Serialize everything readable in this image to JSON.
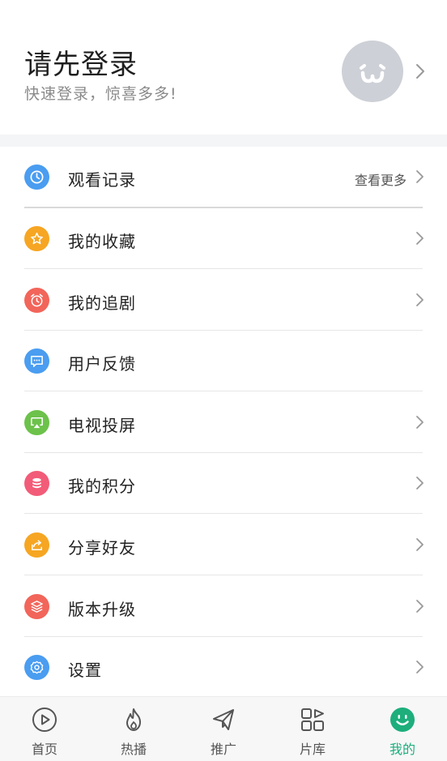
{
  "header": {
    "title": "请先登录",
    "subtitle": "快速登录，惊喜多多!"
  },
  "menu": {
    "items": [
      {
        "id": "history",
        "label": "观看记录",
        "more": "查看更多",
        "icon": "clock-icon",
        "color": "#4a9df0",
        "chevron": true
      },
      {
        "id": "favorites",
        "label": "我的收藏",
        "icon": "star-icon",
        "color": "#f6a623",
        "chevron": true
      },
      {
        "id": "follow",
        "label": "我的追剧",
        "icon": "alarm-icon",
        "color": "#f2655a",
        "chevron": true
      },
      {
        "id": "feedback",
        "label": "用户反馈",
        "icon": "chat-icon",
        "color": "#4a9df0",
        "chevron": false
      },
      {
        "id": "tv-cast",
        "label": "电视投屏",
        "icon": "cast-icon",
        "color": "#6cc24a",
        "chevron": true
      },
      {
        "id": "points",
        "label": "我的积分",
        "icon": "coins-icon",
        "color": "#f25c78",
        "chevron": true
      },
      {
        "id": "share",
        "label": "分享好友",
        "icon": "share-icon",
        "color": "#f6a623",
        "chevron": true
      },
      {
        "id": "upgrade",
        "label": "版本升级",
        "icon": "layers-icon",
        "color": "#f2655a",
        "chevron": true
      },
      {
        "id": "settings",
        "label": "设置",
        "icon": "gear-icon",
        "color": "#4a9df0",
        "chevron": true
      }
    ]
  },
  "tabbar": {
    "tabs": [
      {
        "label": "首页",
        "icon": "play-circle-icon"
      },
      {
        "label": "热播",
        "icon": "flame-icon"
      },
      {
        "label": "推广",
        "icon": "paper-plane-icon"
      },
      {
        "label": "片库",
        "icon": "grid-icon"
      },
      {
        "label": "我的",
        "icon": "smiley-icon",
        "active": true
      }
    ],
    "active_color": "#1dae7c",
    "inactive_color": "#555555"
  }
}
